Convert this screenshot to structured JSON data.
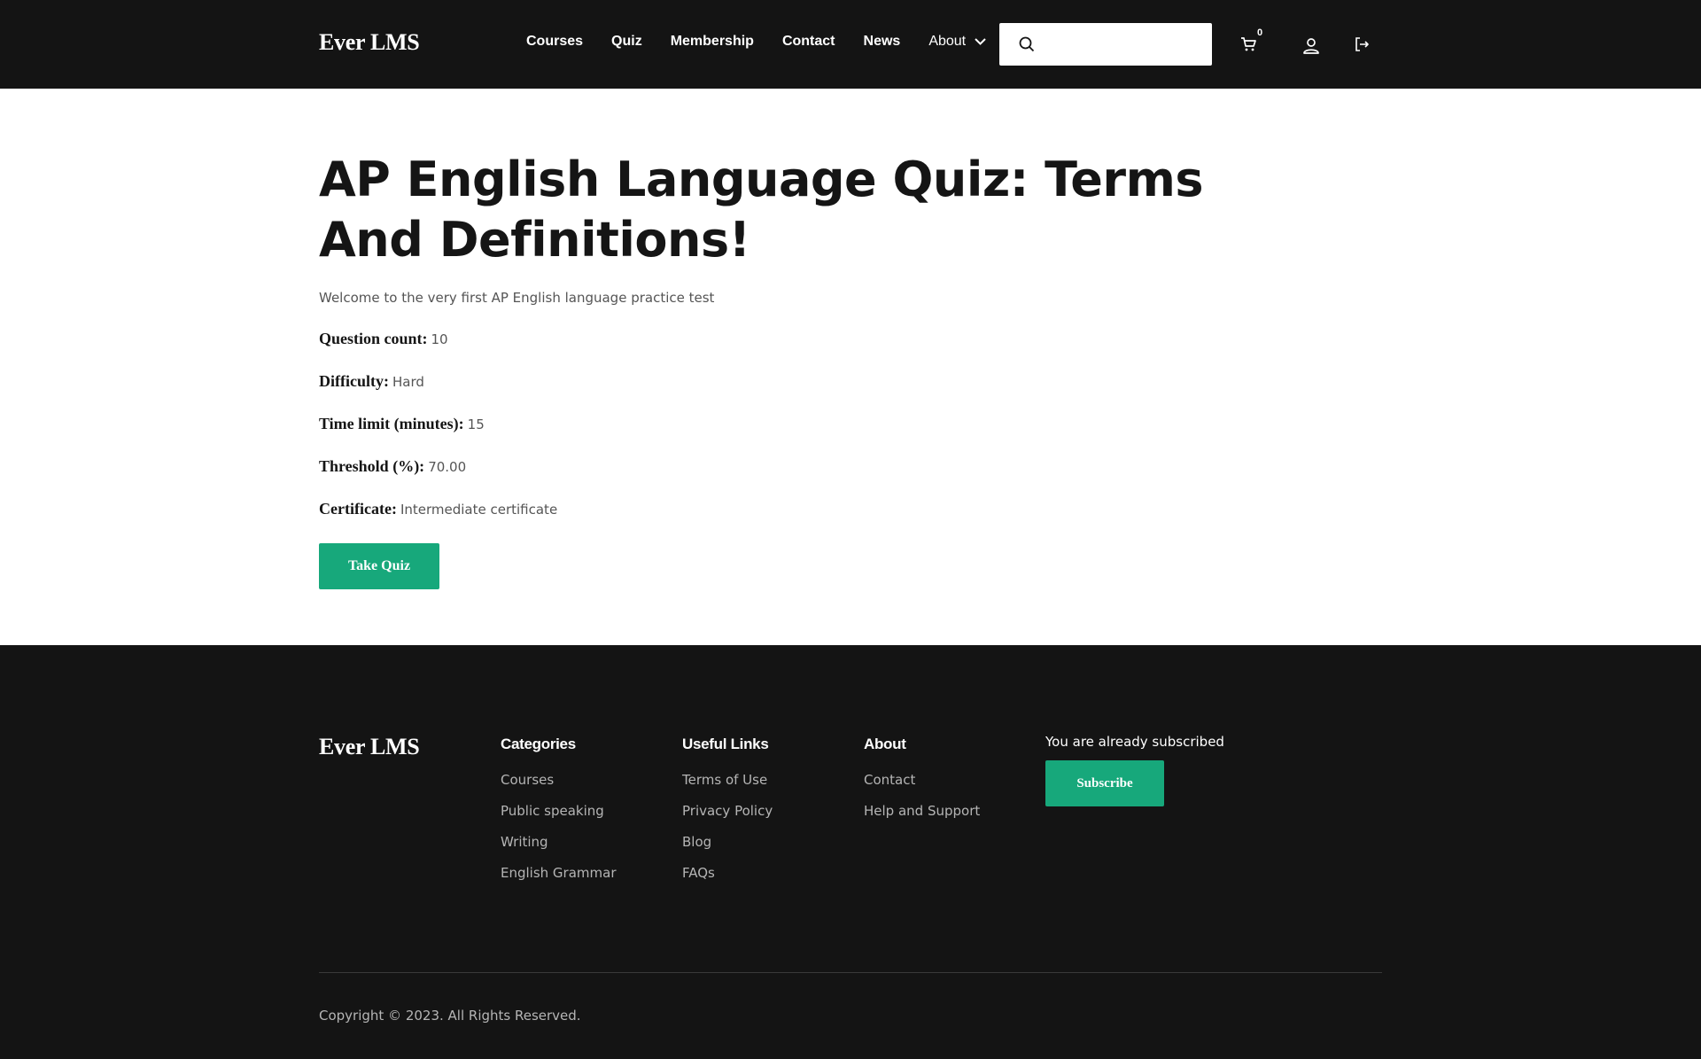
{
  "header": {
    "logo": "Ever LMS",
    "nav": [
      "Courses",
      "Quiz",
      "Membership",
      "Contact",
      "News"
    ],
    "about_label": "About",
    "search_value": "",
    "cart_count": "0"
  },
  "quiz": {
    "title": "AP English Language Quiz: Terms And Definitions!",
    "intro": "Welcome to the very first AP English language practice test",
    "fields": [
      {
        "label": "Question count:",
        "value": "10"
      },
      {
        "label": "Difficulty:",
        "value": "Hard"
      },
      {
        "label": "Time limit (minutes):",
        "value": "15"
      },
      {
        "label": "Threshold (%):",
        "value": "70.00"
      },
      {
        "label": "Certificate:",
        "value": "Intermediate certificate"
      }
    ],
    "take_quiz_label": "Take Quiz"
  },
  "footer": {
    "logo": "Ever LMS",
    "categories": {
      "heading": "Categories",
      "links": [
        "Courses",
        "Public speaking",
        "Writing",
        "English Grammar"
      ]
    },
    "useful_links": {
      "heading": "Useful Links",
      "links": [
        "Terms of Use",
        "Privacy Policy",
        "Blog",
        "FAQs"
      ]
    },
    "about": {
      "heading": "About",
      "links": [
        "Contact",
        "Help and Support"
      ]
    },
    "subscribe_text": "You are already subscribed",
    "subscribe_label": "Subscribe",
    "copyright": "Copyright © 2023. All Rights Reserved."
  },
  "colors": {
    "accent": "#17a87b",
    "dark": "#141414",
    "muted_text": "#b5b5b5"
  }
}
